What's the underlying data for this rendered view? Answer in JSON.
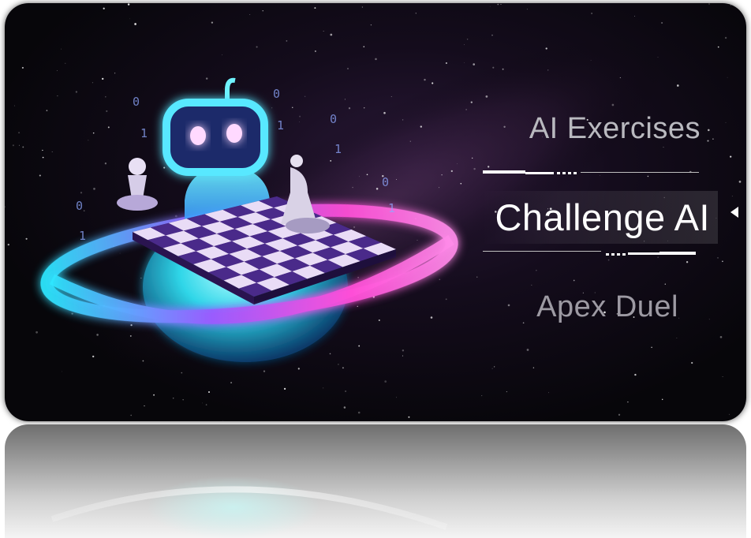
{
  "menu": {
    "items": [
      {
        "label": "AI Exercises",
        "selected": false
      },
      {
        "label": "Challenge AI",
        "selected": true
      },
      {
        "label": "Apex Duel",
        "selected": false
      }
    ]
  },
  "artwork": {
    "binary_digits": [
      "0",
      "1",
      "0",
      "1",
      "0",
      "1",
      "0",
      "1",
      "0",
      "1"
    ],
    "icon_names": [
      "robot-icon",
      "chessboard-icon",
      "pawn-icon",
      "knight-icon",
      "orbit-ring-icon"
    ]
  },
  "colors": {
    "accent_pink": "#ff4fd8",
    "accent_cyan": "#38e8ff",
    "accent_purple": "#9a5cff",
    "selected_text": "#ffffff",
    "menu_text": "#c0c0c6",
    "background": "#07060a"
  }
}
